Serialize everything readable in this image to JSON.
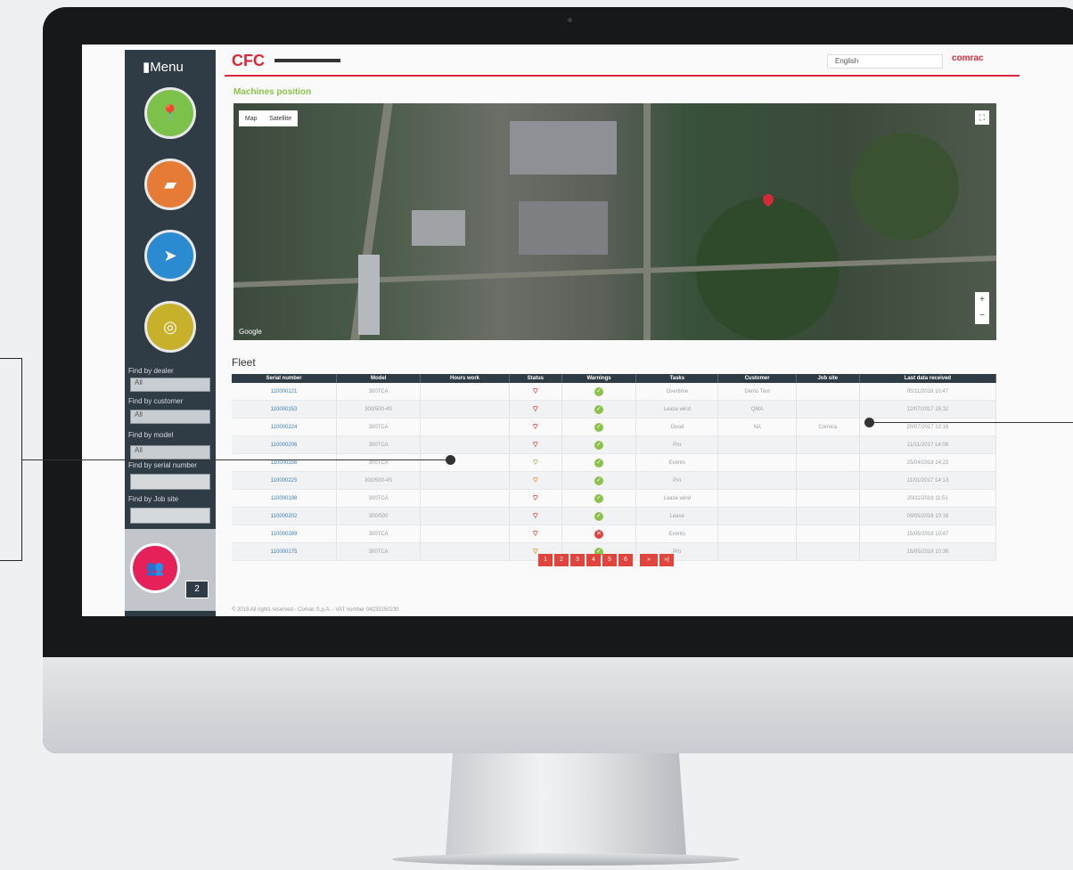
{
  "sidebar": {
    "menu_title": "Menu",
    "filters": [
      {
        "label": "Find by dealer",
        "value": "All"
      },
      {
        "label": "Find by customer",
        "value": "All"
      },
      {
        "label": "Find by model",
        "value": "All"
      }
    ],
    "inputs": [
      {
        "label": "Find by serial number"
      },
      {
        "label": "Find by Job site"
      }
    ],
    "contact_count": "2"
  },
  "header": {
    "logo": "CFC",
    "language": "English",
    "brand": "comrac"
  },
  "map_section": {
    "title": "Machines position",
    "toggle_map": "Map",
    "toggle_satellite": "Satellite",
    "google": "Google"
  },
  "fleet": {
    "title": "Fleet",
    "columns": [
      "Serial number",
      "Model",
      "Hours work",
      "Status",
      "Warnings",
      "Tasks",
      "Customer",
      "Job site",
      "Last data received"
    ],
    "rows": [
      {
        "serial": "110000121",
        "model": "300TCA",
        "hours": "",
        "signal": "red",
        "warning": "ok",
        "task": "Overtime",
        "customer": "Demo Test",
        "site": "",
        "last": "05/11/2018 10:47"
      },
      {
        "serial": "110000153",
        "model": "300/500-4S",
        "hours": "",
        "signal": "red",
        "warning": "ok",
        "task": "Lease wind",
        "customer": "QMA",
        "site": "",
        "last": "12/07/2017 15:32"
      },
      {
        "serial": "110000224",
        "model": "300TCA",
        "hours": "",
        "signal": "red",
        "warning": "ok",
        "task": "Good",
        "customer": "NA",
        "site": "Cornica",
        "last": "20/07/2017 12:16"
      },
      {
        "serial": "110000206",
        "model": "300TCA",
        "hours": "",
        "signal": "red",
        "warning": "ok",
        "task": "Pro",
        "customer": "",
        "site": "",
        "last": "21/11/2017 14:08"
      },
      {
        "serial": "110000156",
        "model": "300TCA",
        "hours": "",
        "signal": "green",
        "warning": "ok",
        "task": "Events",
        "customer": "",
        "site": "",
        "last": "25/04/2018 14:22"
      },
      {
        "serial": "110000225",
        "model": "300/500-4S",
        "hours": "",
        "signal": "orange",
        "warning": "ok",
        "task": "Pro",
        "customer": "",
        "site": "",
        "last": "11/01/2017 14:13"
      },
      {
        "serial": "110000198",
        "model": "300TCA",
        "hours": "",
        "signal": "red",
        "warning": "ok",
        "task": "Lease wind",
        "customer": "",
        "site": "",
        "last": "20/11/2018 11:51"
      },
      {
        "serial": "110000202",
        "model": "300/500",
        "hours": "",
        "signal": "red",
        "warning": "ok",
        "task": "Lease",
        "customer": "",
        "site": "",
        "last": "09/05/2018 10:16"
      },
      {
        "serial": "110000289",
        "model": "300TCA",
        "hours": "",
        "signal": "red",
        "warning": "error",
        "task": "Events",
        "customer": "",
        "site": "",
        "last": "15/05/2018 10:47"
      },
      {
        "serial": "110000175",
        "model": "300TCA",
        "hours": "",
        "signal": "orange",
        "warning": "ok",
        "task": "Pro",
        "customer": "",
        "site": "",
        "last": "15/05/2018 10:36"
      }
    ],
    "pages": [
      "1",
      "2",
      "3",
      "4",
      "5",
      "6",
      "»",
      "»|"
    ]
  },
  "footer": "© 2018 All rights reserved - Comac S.p.A. - VAT number 04233150230",
  "colors": {
    "accent_red": "#d52a3a",
    "accent_green": "#8bc34a",
    "sidebar": "#2f3b45"
  },
  "icons": {
    "menu": [
      "map-pin-icon",
      "book-icon",
      "compass-icon",
      "gauge-icon"
    ],
    "contact": "users-icon"
  }
}
